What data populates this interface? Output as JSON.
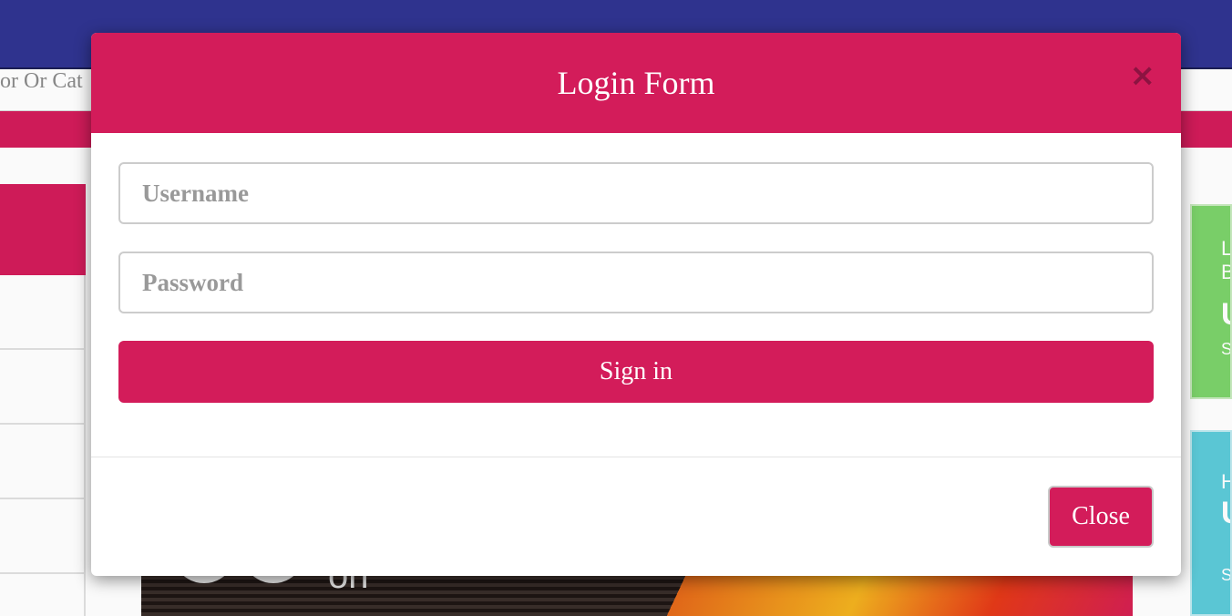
{
  "background": {
    "search_text": "or Or Cat",
    "banner_text": "on",
    "card_green": {
      "line1": "L",
      "line2": "B",
      "big": "U",
      "tiny": "S"
    },
    "card_cyan": {
      "line1": "H",
      "big": "U",
      "tiny": "S"
    }
  },
  "modal": {
    "title": "Login Form",
    "close_icon": "×",
    "username_placeholder": "Username",
    "password_placeholder": "Password",
    "username_value": "",
    "password_value": "",
    "signin_label": "Sign in",
    "close_label": "Close"
  },
  "colors": {
    "brand_pink": "#d31c5a",
    "header_blue": "#303591",
    "card_green": "#7cd36b",
    "card_cyan": "#5ccad9"
  }
}
